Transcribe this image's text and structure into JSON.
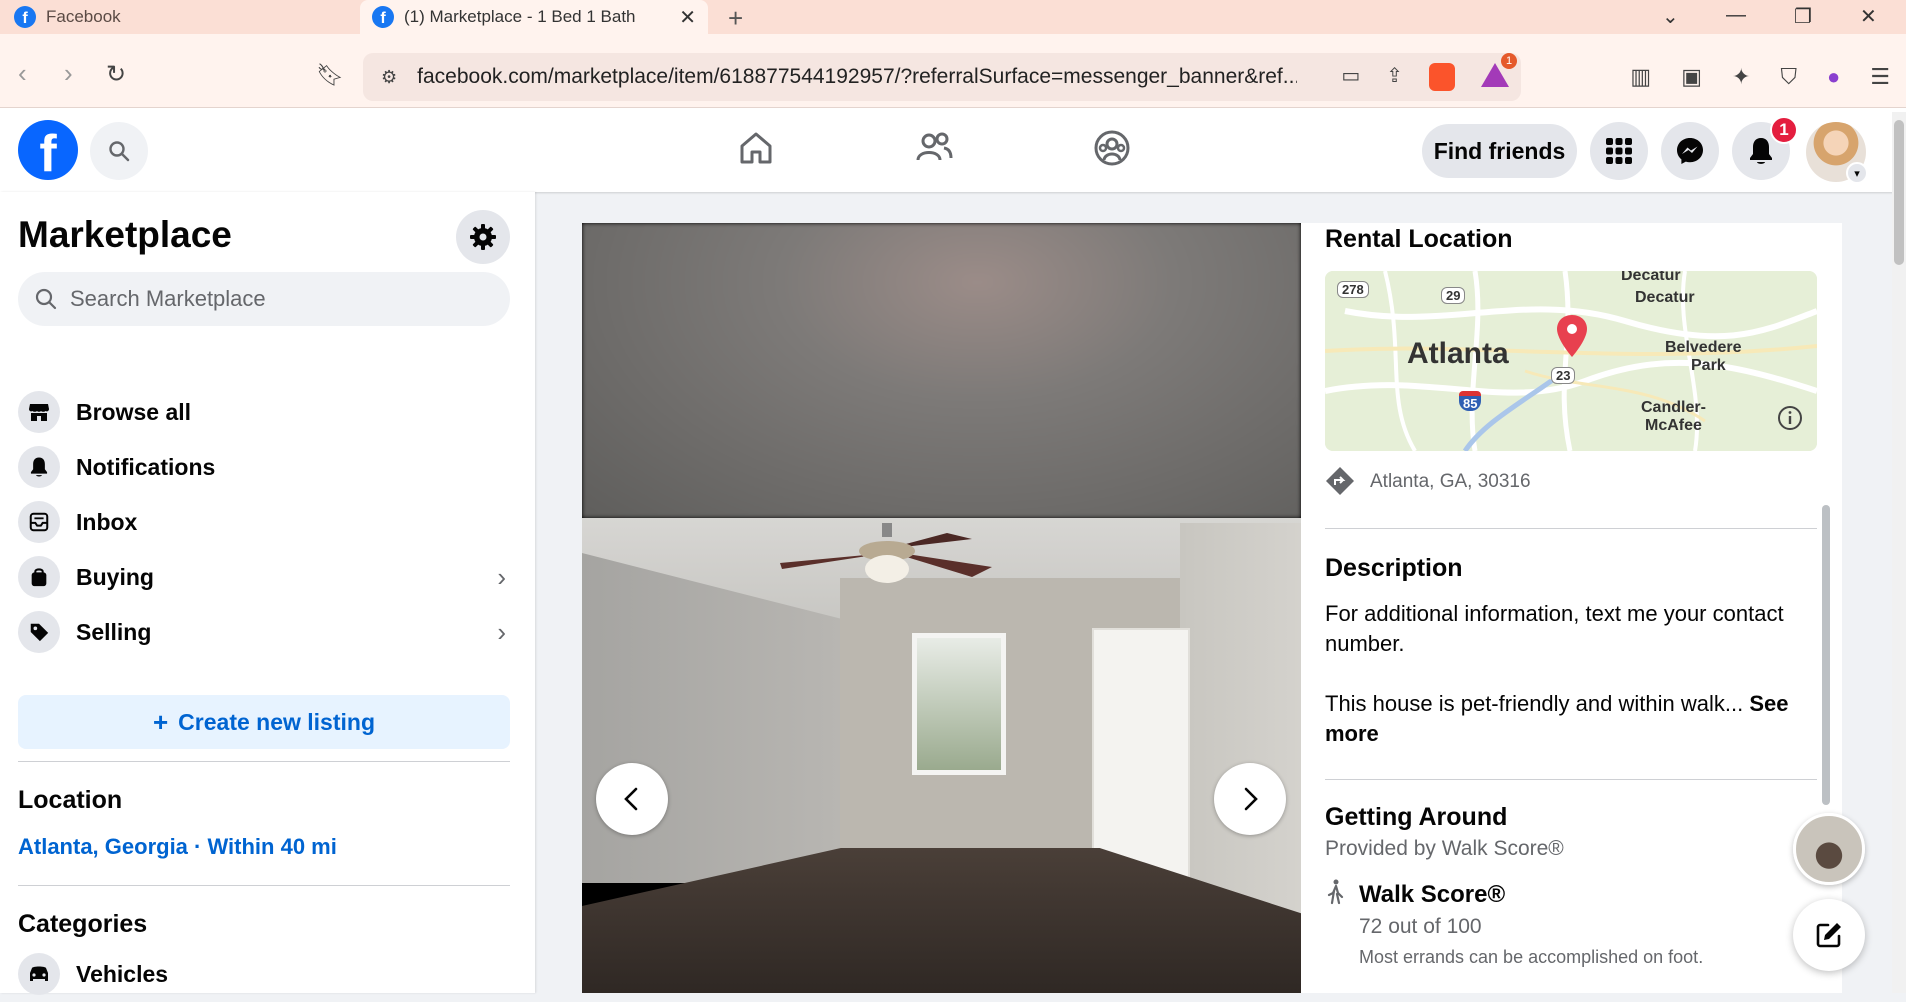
{
  "browser": {
    "tabs": [
      {
        "title": "Facebook",
        "active": false
      },
      {
        "title": "(1) Marketplace - 1 Bed 1 Bath",
        "active": true
      }
    ],
    "new_tab": "+",
    "url": "facebook.com/marketplace/item/618877544192957/?referralSurface=messenger_banner&ref...",
    "brave_badge": "1"
  },
  "fb_header": {
    "logo": "f",
    "find_friends": "Find friends",
    "notifications_count": "1"
  },
  "sidebar": {
    "title": "Marketplace",
    "search_placeholder": "Search Marketplace",
    "items": [
      {
        "label": "Browse all",
        "icon": "storefront-icon"
      },
      {
        "label": "Notifications",
        "icon": "bell-icon"
      },
      {
        "label": "Inbox",
        "icon": "inbox-icon"
      },
      {
        "label": "Buying",
        "icon": "shopping-bag-icon",
        "chevron": true
      },
      {
        "label": "Selling",
        "icon": "tag-icon",
        "chevron": true
      }
    ],
    "create_listing": "Create new listing",
    "create_plus": "+",
    "location_title": "Location",
    "location_value": "Atlanta, Georgia · Within 40 mi",
    "categories_title": "Categories",
    "categories": [
      {
        "label": "Vehicles",
        "icon": "car-icon"
      }
    ]
  },
  "listing": {
    "rental_location_title": "Rental Location",
    "map_labels": {
      "city": "Atlanta",
      "decatur_top": "Decatur",
      "decatur": "Decatur",
      "belvedere": "Belvedere",
      "park": "Park",
      "candler": "Candler-",
      "mcafee": "McAfee",
      "route_278": "278",
      "route_29": "29",
      "route_23": "23",
      "route_85": "85"
    },
    "address": "Atlanta, GA, 30316",
    "description_title": "Description",
    "description_line1": "For additional information, text me your contact number.",
    "description_line2": "This house is pet-friendly and within walk...",
    "see_more": "See more",
    "getting_around_title": "Getting Around",
    "provided_by": "Provided by Walk Score®",
    "walk_score_title": "Walk Score®",
    "walk_score_value": "72 out of 100",
    "walk_score_desc": "Most errands can be accomplished on foot."
  },
  "colors": {
    "fb_blue": "#0866ff",
    "link_blue": "#0064d1",
    "badge_red": "#e41e3f",
    "tab_bar": "#fbdfd5"
  }
}
